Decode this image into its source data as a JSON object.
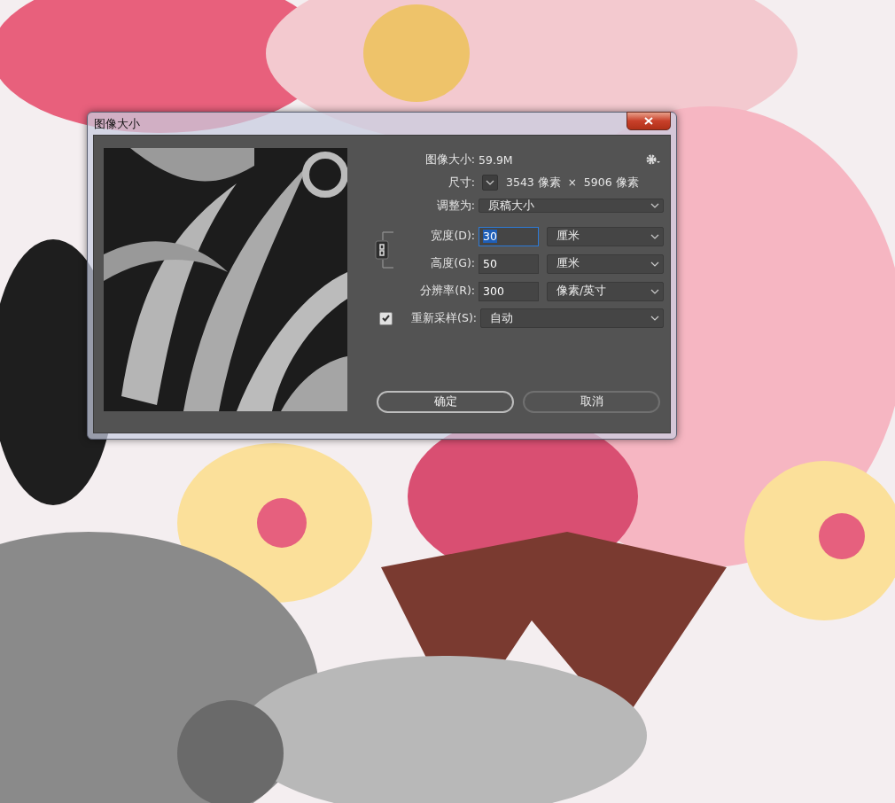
{
  "window": {
    "title": "图像大小"
  },
  "info": {
    "size_label": "图像大小:",
    "size_value": "59.9M",
    "dimensions_label": "尺寸:",
    "width_px": "3543 像素",
    "times": "×",
    "height_px": "5906 像素"
  },
  "fit_to": {
    "label": "调整为:",
    "value": "原稿大小"
  },
  "fields": [
    {
      "label": "宽度(D):",
      "value": "30",
      "unit": "厘米",
      "focused": true
    },
    {
      "label": "高度(G):",
      "value": "50",
      "unit": "厘米",
      "focused": false
    },
    {
      "label": "分辨率(R):",
      "value": "300",
      "unit": "像素/英寸",
      "focused": false
    }
  ],
  "resample": {
    "label": "重新采样(S):",
    "checked": true,
    "value": "自动"
  },
  "buttons": [
    {
      "label": "确定",
      "default": true
    },
    {
      "label": "取消",
      "default": false
    }
  ]
}
